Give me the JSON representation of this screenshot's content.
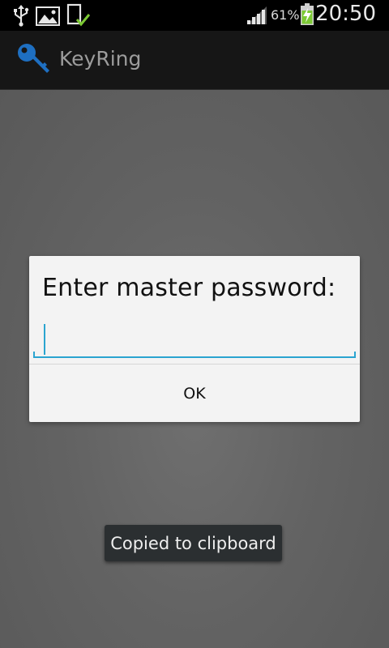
{
  "status_bar": {
    "icons": [
      "usb-icon",
      "image-icon",
      "download-complete-icon",
      "signal-icon",
      "battery-charging-icon"
    ],
    "battery_percent": "61%",
    "time": "20:50",
    "signal_color": "#e6e6e6",
    "battery_color": "#7cc934"
  },
  "action_bar": {
    "app_icon": "key-icon",
    "app_icon_color": "#1e6fc1",
    "title": "KeyRing"
  },
  "dialog": {
    "title": "Enter master password:",
    "password_value": "",
    "ok_label": "OK",
    "accent_color": "#2aa4d0"
  },
  "toast": {
    "message": "Copied to clipboard"
  }
}
